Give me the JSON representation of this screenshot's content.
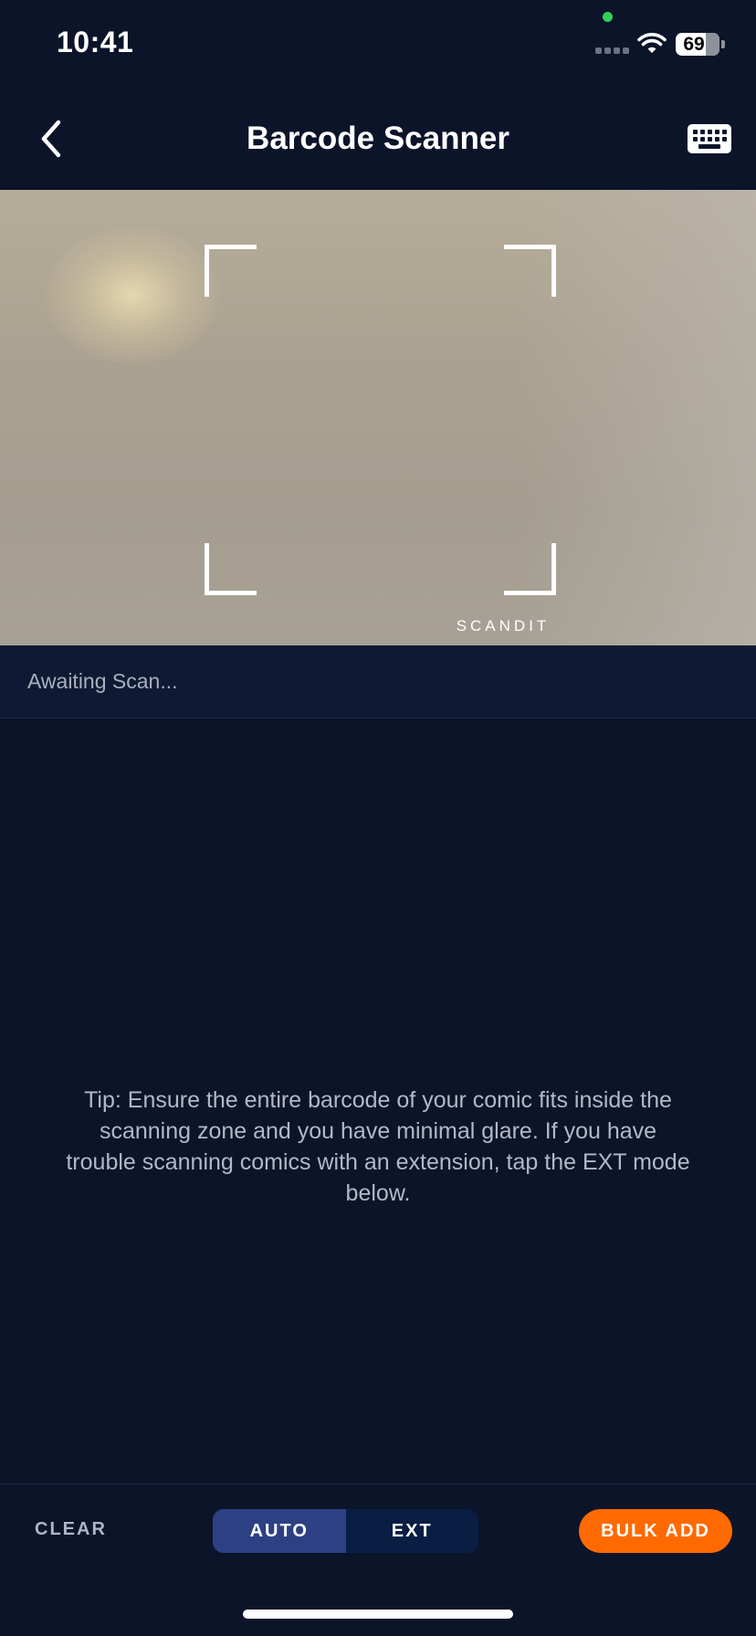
{
  "status_bar": {
    "time": "10:41",
    "battery_level": "69",
    "battery_fraction": 0.69
  },
  "nav": {
    "title": "Barcode Scanner",
    "back_icon": "chevron-left-icon",
    "keyboard_icon": "keyboard-icon"
  },
  "camera": {
    "brand_text": "SCANDIT"
  },
  "scan_status": {
    "text": "Awaiting Scan..."
  },
  "tip": {
    "text": "Tip: Ensure the entire barcode of your comic fits inside the scanning zone and you have minimal glare. If you have trouble scanning comics with an extension, tap the EXT mode below."
  },
  "toolbar": {
    "clear_label": "CLEAR",
    "modes": [
      {
        "label": "AUTO",
        "active": true
      },
      {
        "label": "EXT",
        "active": false
      }
    ],
    "bulk_add_label": "BULK ADD"
  },
  "colors": {
    "background": "#0c142a",
    "accent": "#ff6a00",
    "active_mode": "#2d4083"
  }
}
